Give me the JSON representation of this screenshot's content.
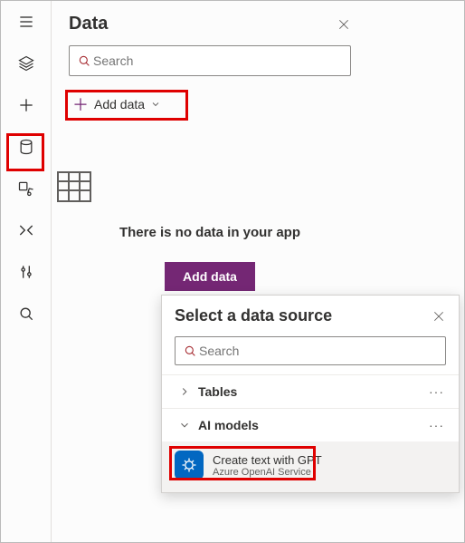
{
  "panel": {
    "title": "Data",
    "search_placeholder": "Search",
    "add_data_label": "Add data",
    "empty_text": "There is no data in your app",
    "add_data_primary": "Add data"
  },
  "popup": {
    "title": "Select a data source",
    "search_placeholder": "Search",
    "groups": [
      {
        "label": "Tables",
        "expanded": false
      },
      {
        "label": "AI models",
        "expanded": true
      }
    ],
    "ai_items": [
      {
        "name": "Create text with GPT",
        "provider": "Azure OpenAI Service"
      }
    ]
  },
  "rail": {
    "items": [
      "menu",
      "layers",
      "add",
      "data",
      "media",
      "advanced",
      "settings",
      "search"
    ]
  },
  "highlights": {
    "rail_data": true,
    "add_data": true,
    "ai_models": true
  }
}
